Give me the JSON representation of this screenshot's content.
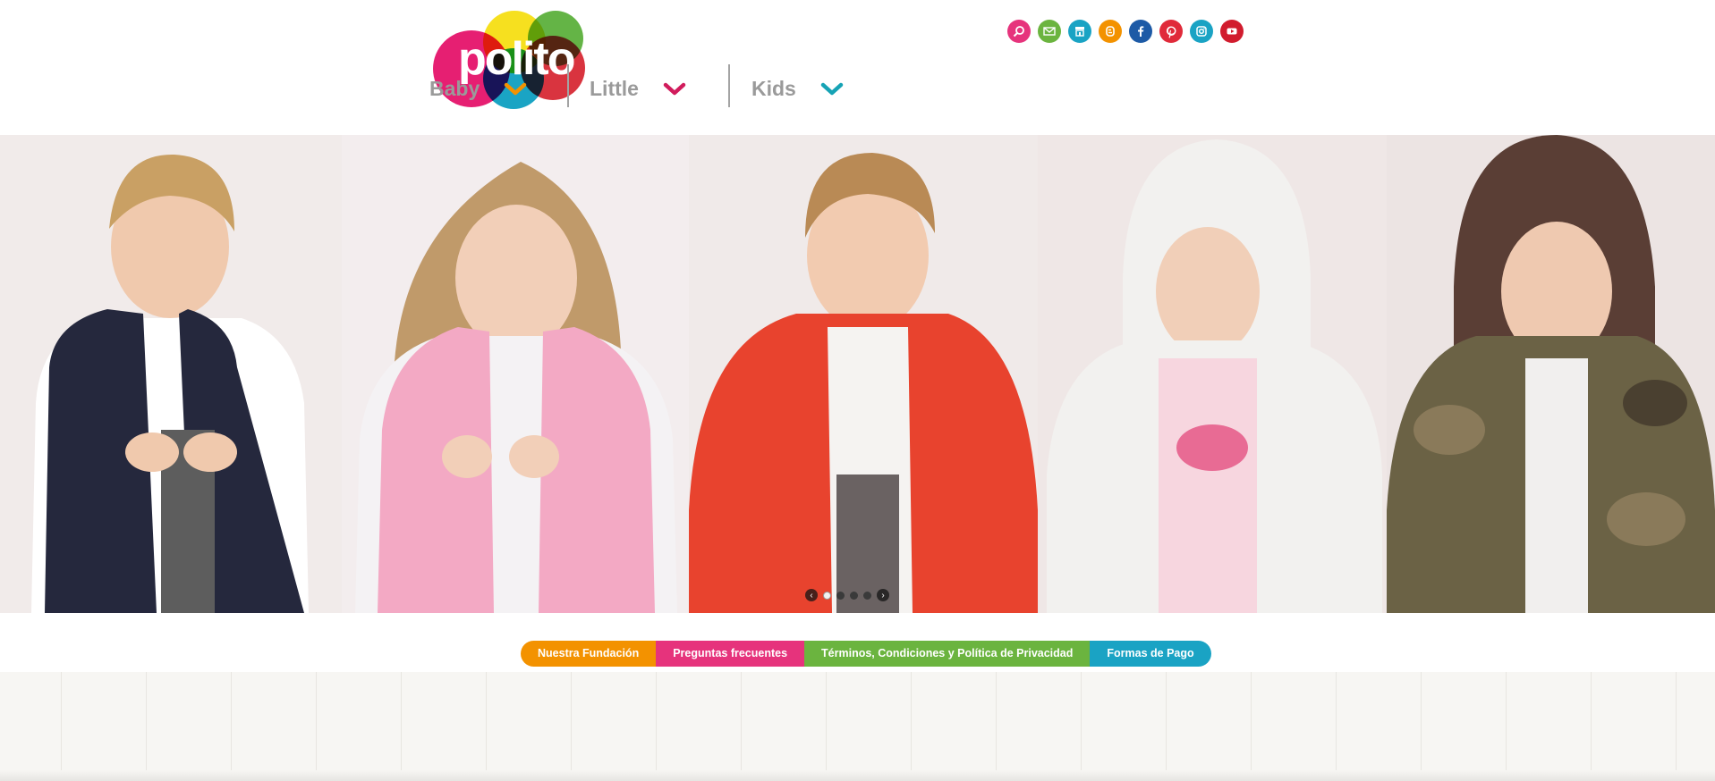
{
  "brand": {
    "logo_text": "polito",
    "logo_colors": [
      "#f6e01f",
      "#64b446",
      "#e61f72",
      "#1aa4c4",
      "#d9343f"
    ]
  },
  "nav": {
    "items": [
      {
        "label": "Baby",
        "chevron_color": "#f39200"
      },
      {
        "label": "Little",
        "chevron_color": "#d11c5c"
      },
      {
        "label": "Kids",
        "chevron_color": "#16a3b5"
      }
    ]
  },
  "social": [
    {
      "icon": "search-icon",
      "color": "#e6337c"
    },
    {
      "icon": "mail-icon",
      "color": "#6bb43f"
    },
    {
      "icon": "store-icon",
      "color": "#1aa3c4"
    },
    {
      "icon": "blogger-icon",
      "color": "#f39200"
    },
    {
      "icon": "facebook-icon",
      "color": "#1d5aa6"
    },
    {
      "icon": "pinterest-icon",
      "color": "#e02a3a"
    },
    {
      "icon": "instagram-icon",
      "color": "#1aa3c4"
    },
    {
      "icon": "youtube-icon",
      "color": "#d11c2e"
    }
  ],
  "hero": {
    "slides_count": 5,
    "active_slide": 0,
    "panels": [
      {
        "name": "boy-navy-vest",
        "jacket_color": "#25283d",
        "bg": "#f1ebea"
      },
      {
        "name": "girl-pink-heart-vest",
        "jacket_color": "#f3a9c4",
        "bg": "#f3edee"
      },
      {
        "name": "boy-red-jacket",
        "jacket_color": "#e8432e",
        "bg": "#f0eae9"
      },
      {
        "name": "girl-white-hooded-jacket",
        "jacket_color": "#f2f1ef",
        "bg": "#efe7e6"
      },
      {
        "name": "boy-camo-hooded-jacket",
        "jacket_color": "#6b6245",
        "bg": "#ece4e3"
      }
    ]
  },
  "footer_links": [
    {
      "label": "Nuestra Fundación",
      "color": "#f39200"
    },
    {
      "label": "Preguntas frecuentes",
      "color": "#e6337c"
    },
    {
      "label": "Términos, Condiciones y Política de Privacidad",
      "color": "#6bb43f"
    },
    {
      "label": "Formas de Pago",
      "color": "#1aa3c4"
    }
  ]
}
